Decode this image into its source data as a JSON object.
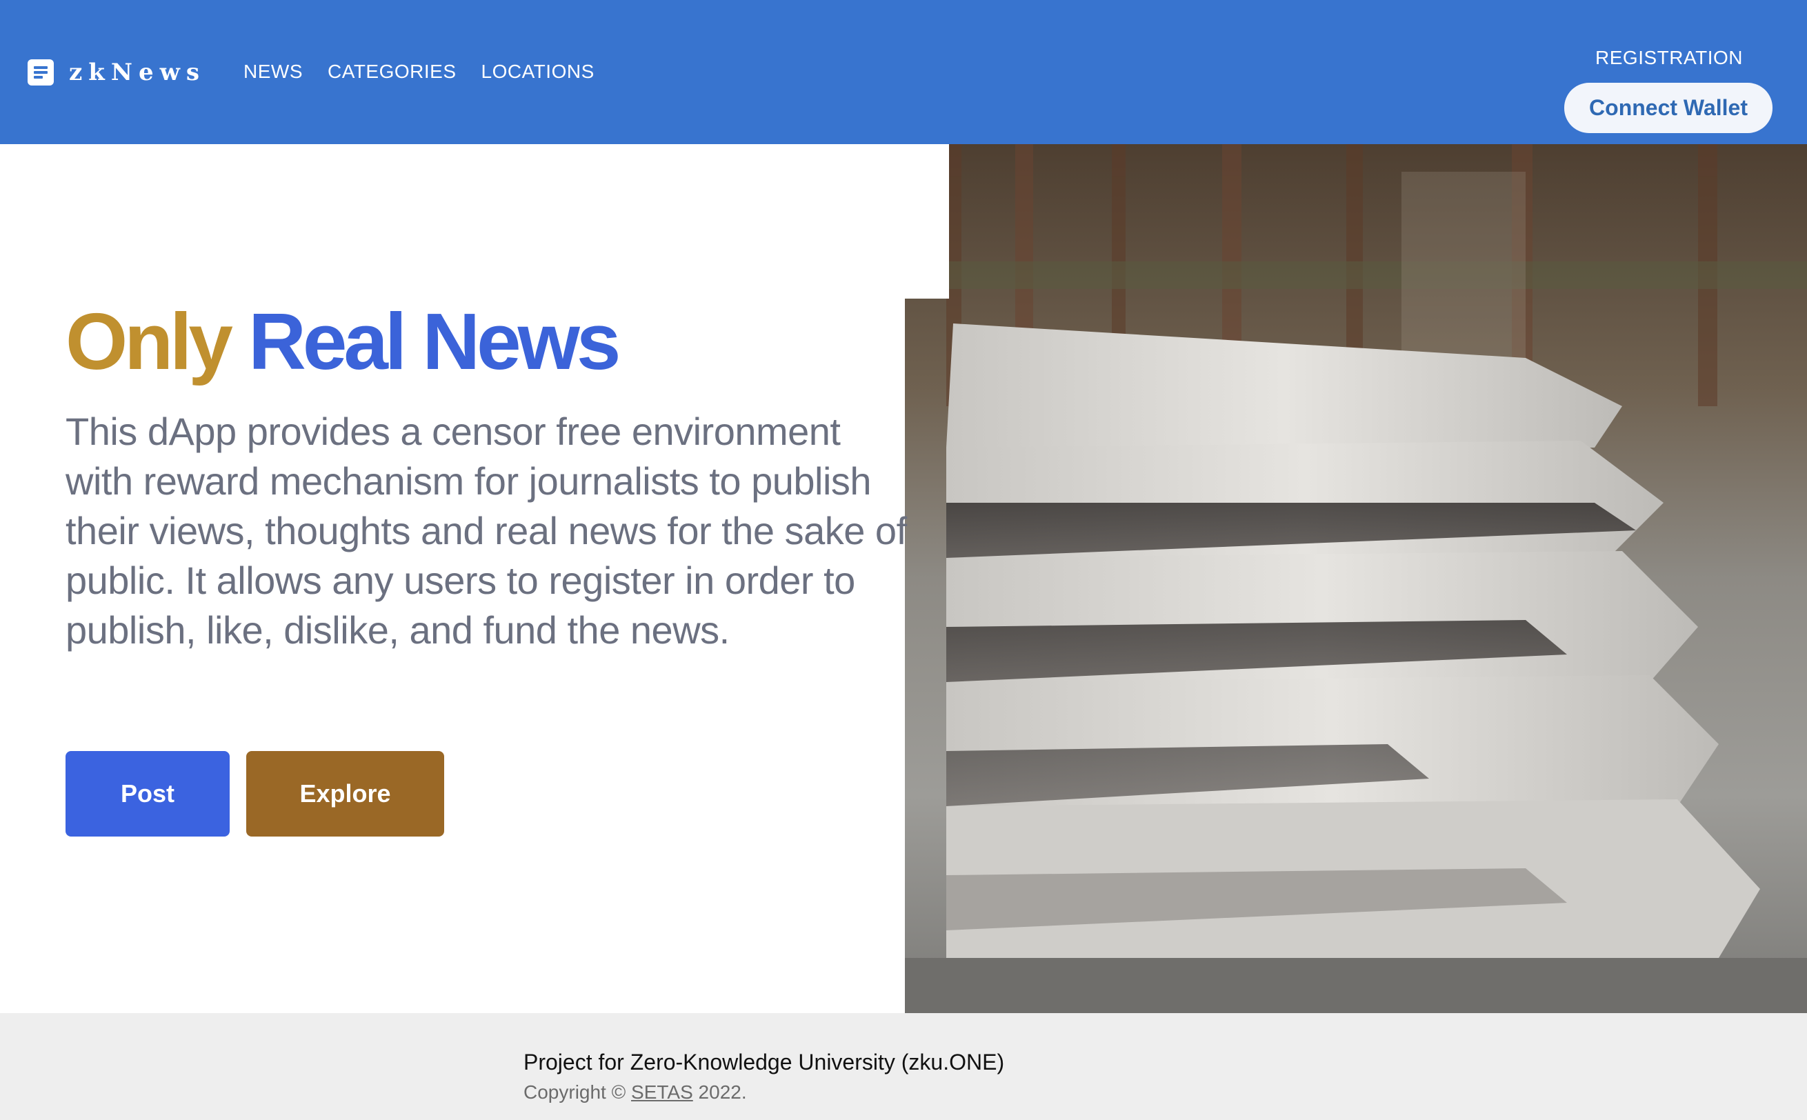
{
  "header": {
    "brand": {
      "icon": "newspaper-icon",
      "name": "zkNews"
    },
    "nav": [
      {
        "label": "NEWS"
      },
      {
        "label": "CATEGORIES"
      },
      {
        "label": "LOCATIONS"
      }
    ],
    "registration_label": "REGISTRATION",
    "connect_wallet_label": "Connect Wallet"
  },
  "hero": {
    "headline_part1": "Only",
    "headline_part2": "Real News",
    "description": "This dApp provides a censor free environment with reward mechanism for journalists to publish their views, thoughts and real news for the sake of public. It allows any users to register in order to publish, like, dislike, and fund the news.",
    "post_label": "Post",
    "explore_label": "Explore",
    "image": "stack-of-newspapers-photo"
  },
  "footer": {
    "project_text": "Project for Zero-Knowledge University (zku.ONE)",
    "copyright_prefix": "Copyright ©",
    "copyright_link": "SETAS",
    "copyright_year": "2022."
  },
  "colors": {
    "navbar": "#3874cf",
    "headline_gold": "#c0902f",
    "headline_blue": "#3b63d9",
    "post_button": "#3b63e0",
    "explore_button": "#9a6826",
    "footer_bg": "#eeeeee"
  }
}
